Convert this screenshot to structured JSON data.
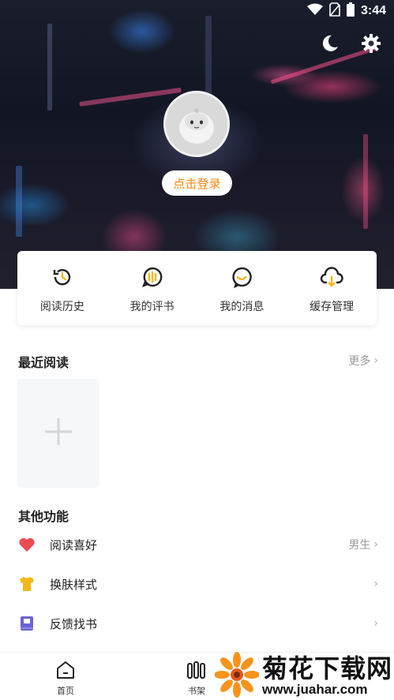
{
  "status_bar": {
    "time": "3:44"
  },
  "header": {
    "login_label": "点击登录"
  },
  "quick_actions": [
    {
      "label": "阅读历史",
      "icon": "history-icon"
    },
    {
      "label": "我的评书",
      "icon": "comment-book-icon"
    },
    {
      "label": "我的消息",
      "icon": "message-icon"
    },
    {
      "label": "缓存管理",
      "icon": "cloud-download-icon"
    }
  ],
  "recent": {
    "title": "最近阅读",
    "more_label": "更多"
  },
  "other": {
    "title": "其他功能",
    "items": [
      {
        "label": "阅读喜好",
        "value": "男生",
        "icon": "heart-icon"
      },
      {
        "label": "换肤样式",
        "value": "",
        "icon": "tshirt-icon"
      },
      {
        "label": "反馈找书",
        "value": "",
        "icon": "book-icon"
      }
    ]
  },
  "bottom_nav": [
    {
      "label": "首页",
      "icon": "home-icon"
    },
    {
      "label": "书架",
      "icon": "bookshelf-icon"
    }
  ],
  "watermark": {
    "title": "菊花下载网",
    "url": "www.juahar.com"
  },
  "colors": {
    "accent": "#f28a14",
    "icon_dark": "#222222",
    "heart": "#ef4b55",
    "tshirt": "#f5b818",
    "book": "#6b63d6"
  }
}
